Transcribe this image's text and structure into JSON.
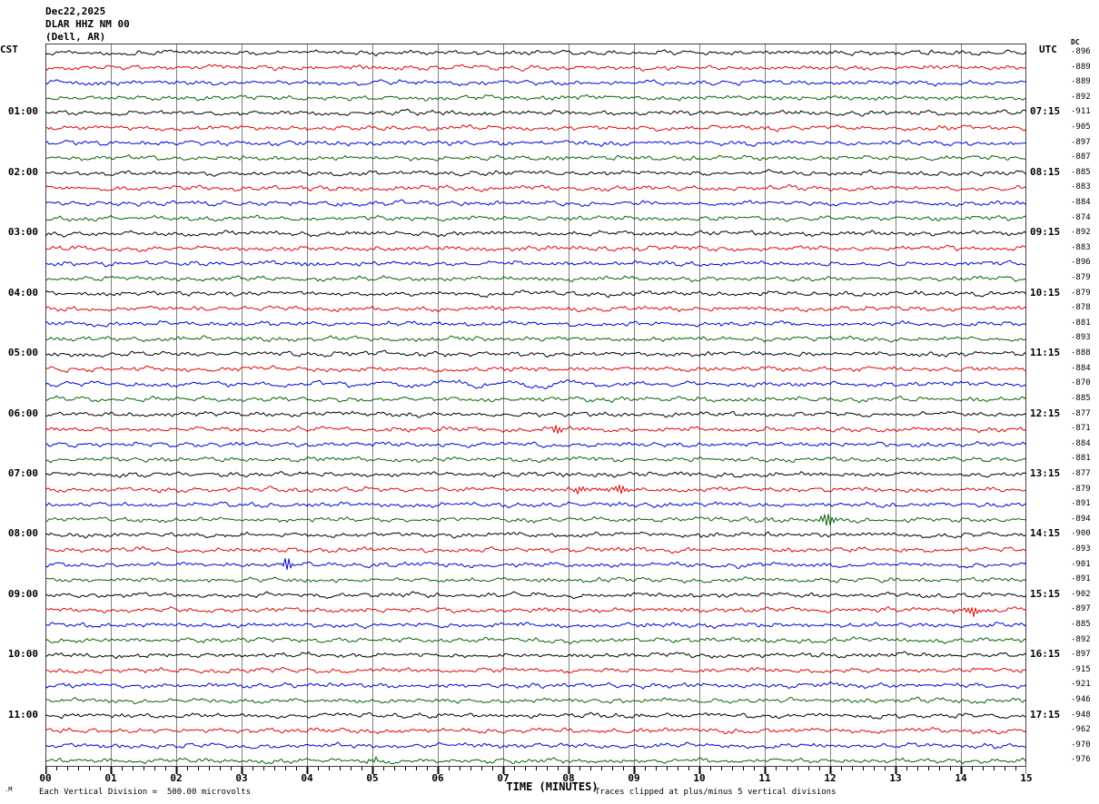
{
  "title": {
    "date": "Dec22,2025",
    "station": "DLAR HHZ NM 00",
    "location": "(Dell, AR)"
  },
  "axes": {
    "left_header": "CST",
    "right_header": "UTC",
    "dc_header": "DC",
    "x_axis_title": "TIME (MINUTES)",
    "x_ticks": [
      "00",
      "01",
      "02",
      "03",
      "04",
      "05",
      "06",
      "07",
      "08",
      "09",
      "10",
      "11",
      "12",
      "13",
      "14",
      "15"
    ]
  },
  "footer": {
    "division_note": "Each Vertical Division =  500.00 microvolts",
    "clip_note": "Traces clipped at plus/minus 5 vertical divisions",
    "logo_mark": ".M"
  },
  "colors": {
    "background": "#ffffff",
    "trace_cycle": [
      "#000000",
      "#e60000",
      "#0000dd",
      "#006600"
    ],
    "grid": "#808080",
    "frame": "#404040",
    "tick": "#000000"
  },
  "chart_data": {
    "type": "line",
    "description": "Helicorder seismogram: 48 trace rows of 15 minutes each (4 rows per hour), color cycle black/red/blue/green, continuous background noise clipped at +/-5 vertical divisions.",
    "x_range_minutes": [
      0,
      15
    ],
    "minutes_per_row": 15,
    "rows_per_hour": 4,
    "rows": [
      {
        "dc": -896,
        "color": "black"
      },
      {
        "dc": -889,
        "color": "red"
      },
      {
        "dc": -889,
        "color": "blue"
      },
      {
        "dc": -892,
        "color": "green"
      },
      {
        "cst": "01:00",
        "utc": "07:15",
        "dc": -911,
        "color": "black"
      },
      {
        "dc": -905,
        "color": "red"
      },
      {
        "dc": -897,
        "color": "blue"
      },
      {
        "dc": -887,
        "color": "green"
      },
      {
        "cst": "02:00",
        "utc": "08:15",
        "dc": -885,
        "color": "black"
      },
      {
        "dc": -883,
        "color": "red"
      },
      {
        "dc": -884,
        "color": "blue"
      },
      {
        "dc": -874,
        "color": "green"
      },
      {
        "cst": "03:00",
        "utc": "09:15",
        "dc": -892,
        "color": "black"
      },
      {
        "dc": -883,
        "color": "red"
      },
      {
        "dc": -896,
        "color": "blue"
      },
      {
        "dc": -879,
        "color": "green"
      },
      {
        "cst": "04:00",
        "utc": "10:15",
        "dc": -879,
        "color": "black"
      },
      {
        "dc": -878,
        "color": "red"
      },
      {
        "dc": -881,
        "color": "blue"
      },
      {
        "dc": -893,
        "color": "green"
      },
      {
        "cst": "05:00",
        "utc": "11:15",
        "dc": -888,
        "color": "black"
      },
      {
        "dc": -884,
        "color": "red"
      },
      {
        "dc": -870,
        "color": "blue"
      },
      {
        "dc": -885,
        "color": "green"
      },
      {
        "cst": "06:00",
        "utc": "12:15",
        "dc": -877,
        "color": "black"
      },
      {
        "dc": -871,
        "color": "red"
      },
      {
        "dc": -884,
        "color": "blue"
      },
      {
        "dc": -881,
        "color": "green"
      },
      {
        "cst": "07:00",
        "utc": "13:15",
        "dc": -877,
        "color": "black"
      },
      {
        "dc": -879,
        "color": "red"
      },
      {
        "dc": -891,
        "color": "blue"
      },
      {
        "dc": -894,
        "color": "green"
      },
      {
        "cst": "08:00",
        "utc": "14:15",
        "dc": -900,
        "color": "black"
      },
      {
        "dc": -893,
        "color": "red"
      },
      {
        "dc": -901,
        "color": "blue"
      },
      {
        "dc": -891,
        "color": "green"
      },
      {
        "cst": "09:00",
        "utc": "15:15",
        "dc": -902,
        "color": "black"
      },
      {
        "dc": -897,
        "color": "red"
      },
      {
        "dc": -885,
        "color": "blue"
      },
      {
        "dc": -892,
        "color": "green"
      },
      {
        "cst": "10:00",
        "utc": "16:15",
        "dc": -897,
        "color": "black"
      },
      {
        "dc": -915,
        "color": "red"
      },
      {
        "dc": -921,
        "color": "blue"
      },
      {
        "dc": -946,
        "color": "green"
      },
      {
        "cst": "11:00",
        "utc": "17:15",
        "dc": -948,
        "color": "black"
      },
      {
        "dc": -962,
        "color": "red"
      },
      {
        "dc": -970,
        "color": "blue"
      },
      {
        "dc": -976,
        "color": "green"
      }
    ],
    "events": [
      {
        "row": 22,
        "minute": 6.5,
        "amp": 2.8,
        "dur": 5.0,
        "note": "long-period swell on blue trace"
      },
      {
        "row": 25,
        "minute": 7.8,
        "amp": 5.0,
        "dur": 0.12,
        "note": "small spike on red trace"
      },
      {
        "row": 29,
        "minute": 8.2,
        "amp": 3.0,
        "dur": 0.3,
        "note": "burst on red trace"
      },
      {
        "row": 29,
        "minute": 8.75,
        "amp": 4.5,
        "dur": 0.2,
        "note": "burst on red trace"
      },
      {
        "row": 31,
        "minute": 11.95,
        "amp": 6.0,
        "dur": 0.25,
        "note": "burst on green trace"
      },
      {
        "row": 34,
        "minute": 3.7,
        "amp": 6.0,
        "dur": 0.12,
        "note": "spike on blue trace"
      },
      {
        "row": 37,
        "minute": 14.2,
        "amp": 4.5,
        "dur": 0.35,
        "note": "burst on red trace"
      },
      {
        "row": 47,
        "minute": 5.0,
        "amp": 2.0,
        "dur": 0.3,
        "note": "small burst on green trace"
      }
    ],
    "clip_divisions": 5,
    "microvolts_per_division": 500.0
  }
}
